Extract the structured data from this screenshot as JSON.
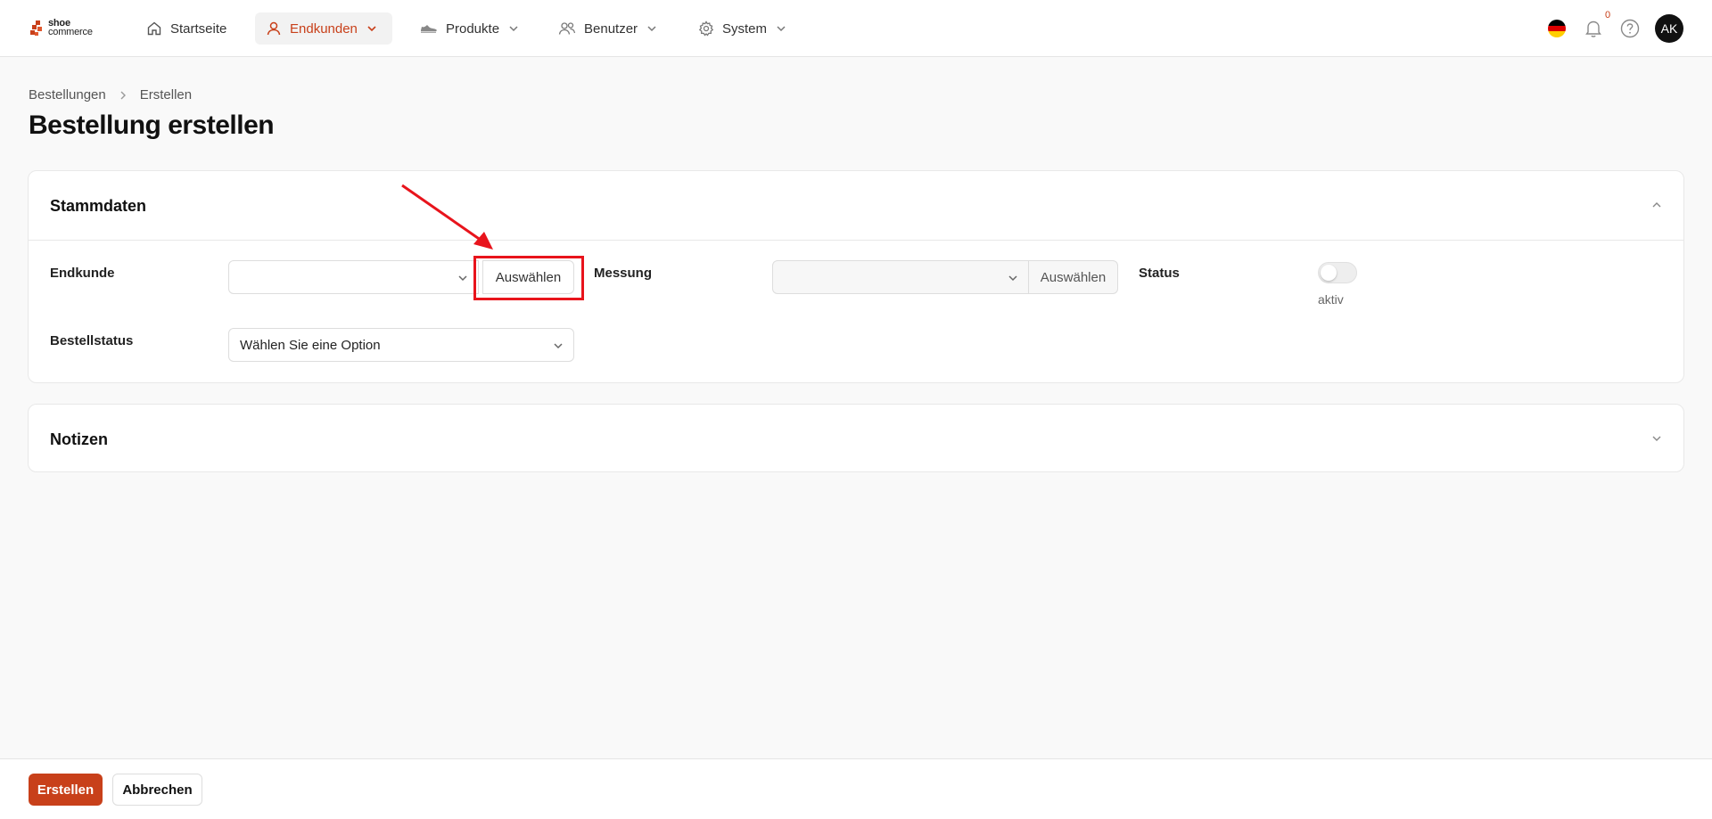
{
  "app": {
    "logo_line1": "shoe",
    "logo_line2": "commerce",
    "brand_color": "#c8401a"
  },
  "nav": {
    "items": [
      {
        "label": "Startseite",
        "icon": "home-icon",
        "active": false
      },
      {
        "label": "Endkunden",
        "icon": "user-icon",
        "active": true
      },
      {
        "label": "Produkte",
        "icon": "shoe-icon",
        "active": false
      },
      {
        "label": "Benutzer",
        "icon": "users-icon",
        "active": false
      },
      {
        "label": "System",
        "icon": "gear-icon",
        "active": false
      }
    ]
  },
  "header_right": {
    "language_flag": "de-flag-icon",
    "notification_count": "0",
    "help_icon": "help-icon",
    "avatar_initials": "AK"
  },
  "breadcrumb": {
    "items": [
      "Bestellungen",
      "Erstellen"
    ]
  },
  "page": {
    "title": "Bestellung erstellen"
  },
  "stammdaten": {
    "title": "Stammdaten",
    "endkunde_label": "Endkunde",
    "endkunde_value": "",
    "endkunde_button": "Auswählen",
    "messung_label": "Messung",
    "messung_value": "",
    "messung_button": "Auswählen",
    "status_label": "Status",
    "status_toggle_label": "aktiv",
    "status_on": false,
    "bestellstatus_label": "Bestellstatus",
    "bestellstatus_value": "Wählen Sie eine Option"
  },
  "notizen": {
    "title": "Notizen"
  },
  "footer": {
    "create_label": "Erstellen",
    "cancel_label": "Abbrechen"
  },
  "annotation": {
    "highlight_color": "#e8141c"
  }
}
